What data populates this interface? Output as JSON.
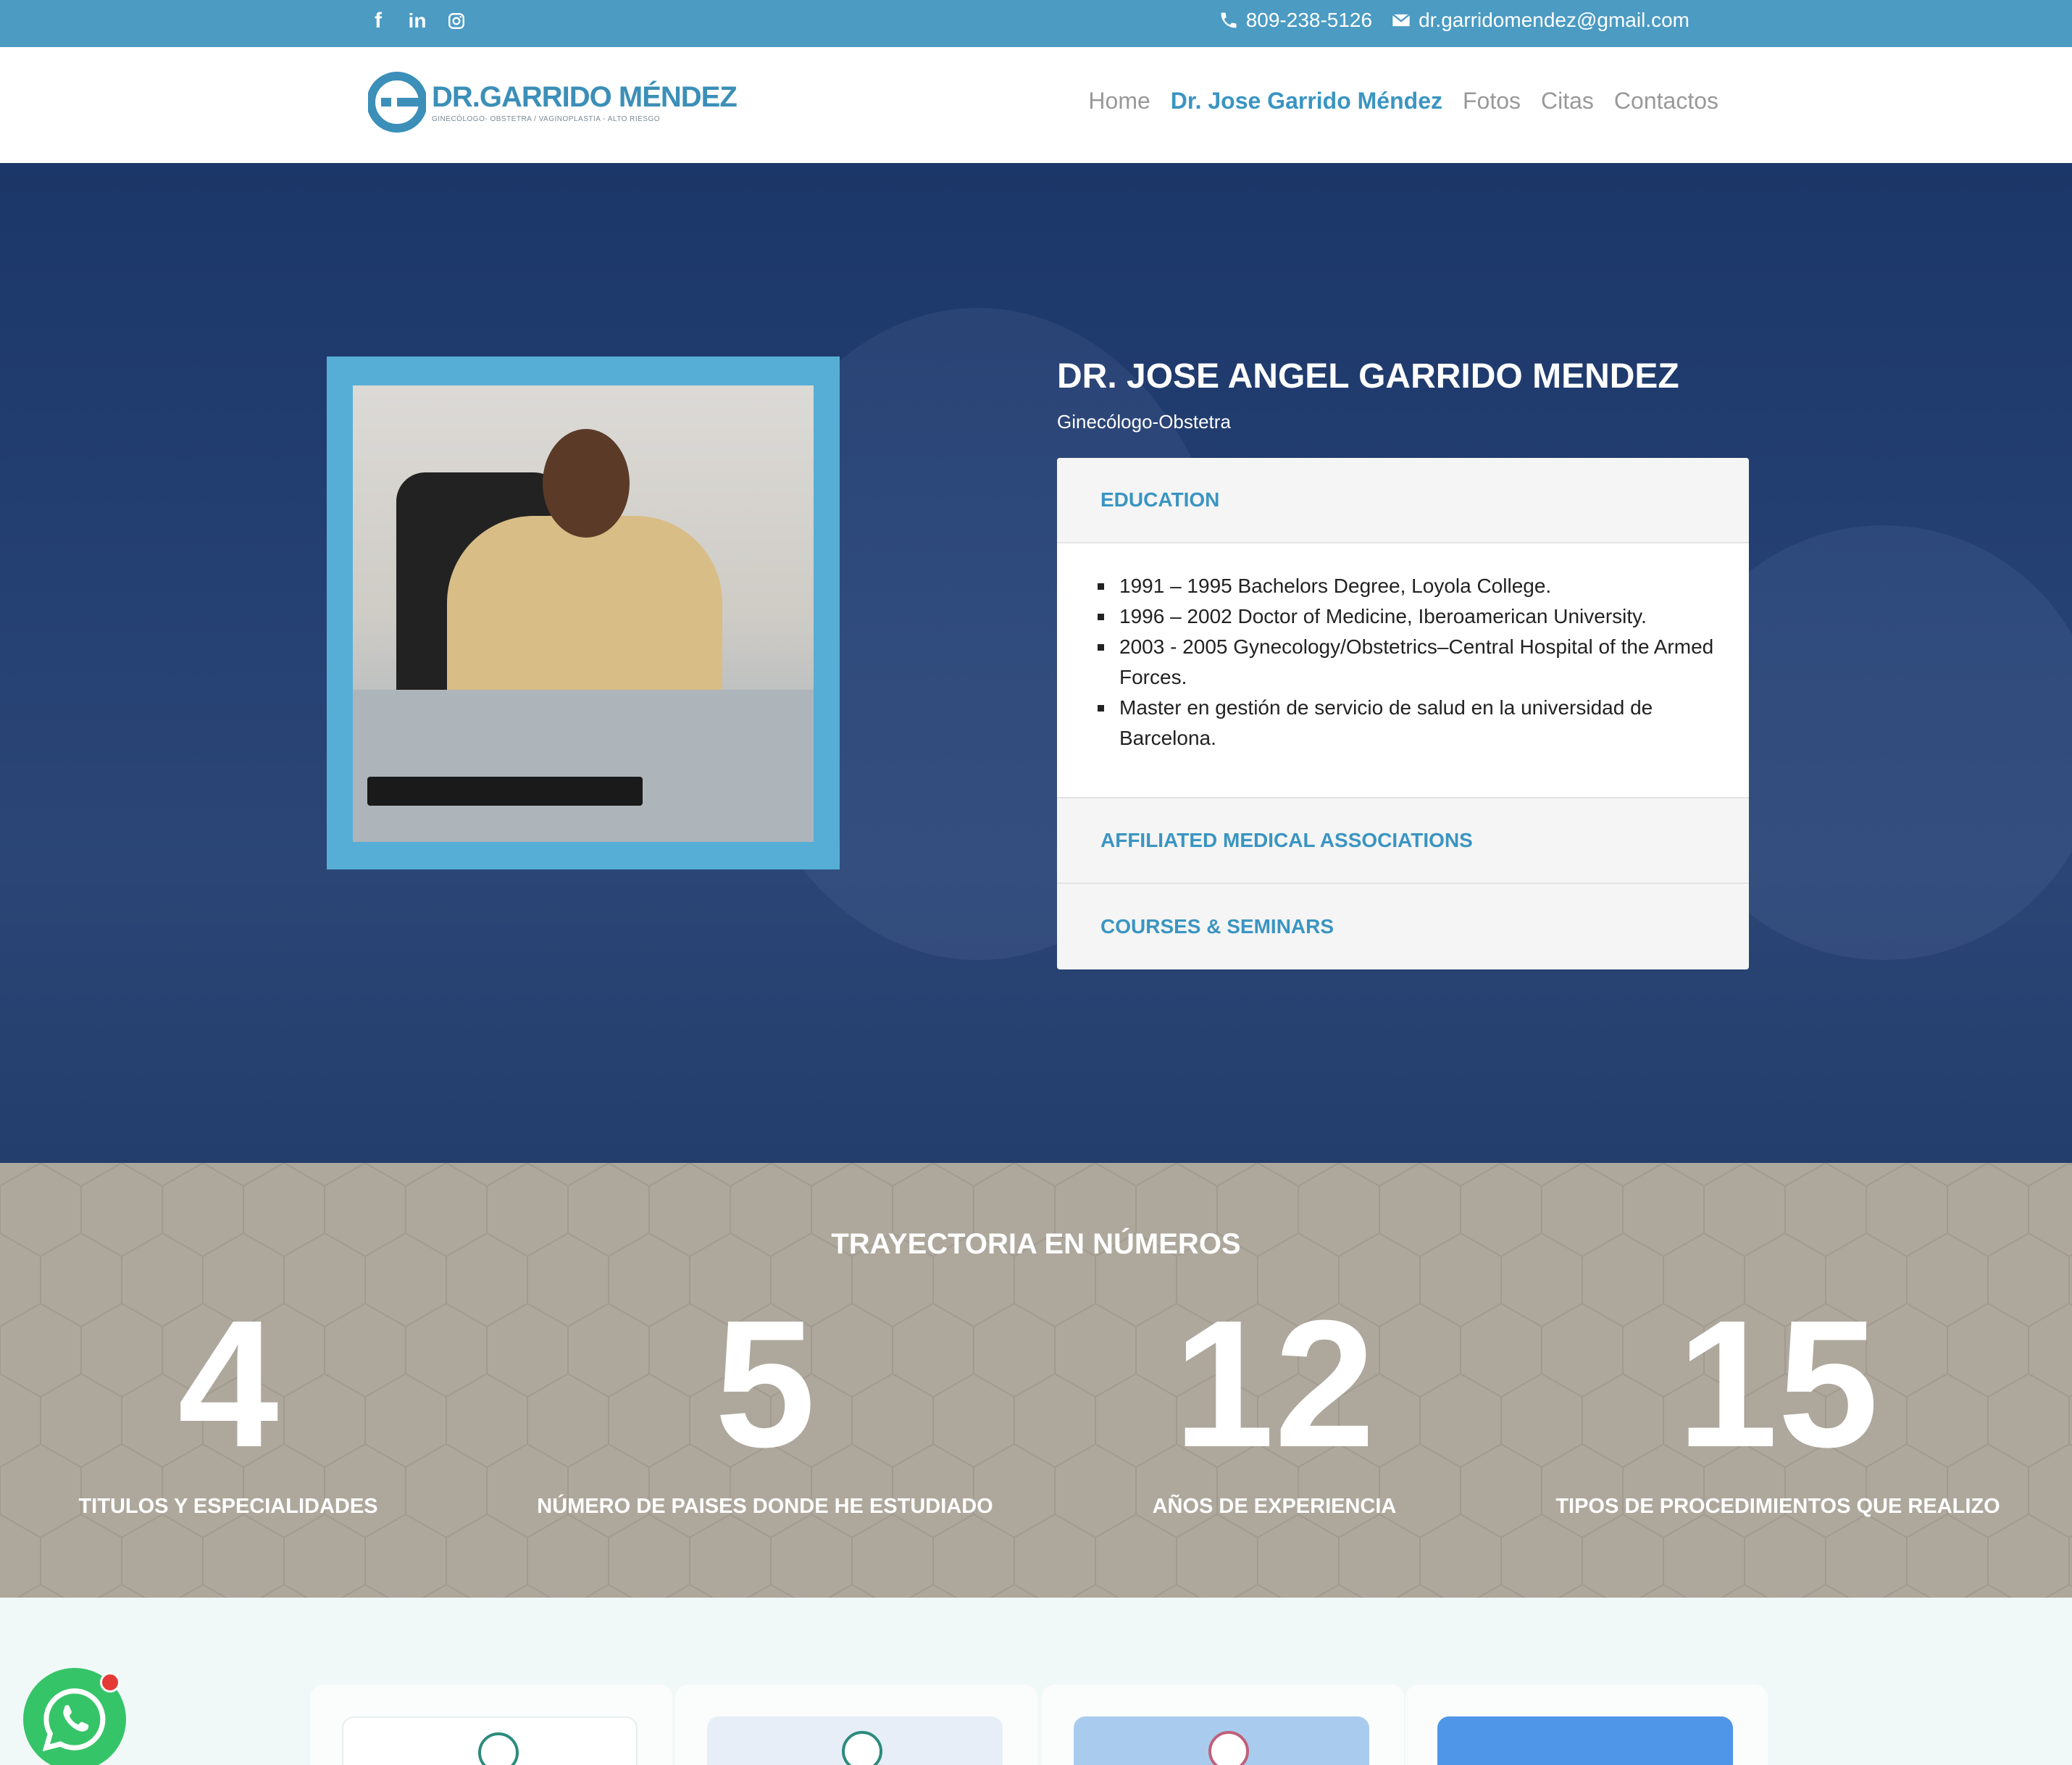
{
  "topbar": {
    "social": [
      "facebook-icon",
      "linkedin-icon",
      "instagram-icon"
    ],
    "phone": "809-238-5126",
    "email": "dr.garridomendez@gmail.com"
  },
  "header": {
    "logo_name": "DR.GARRIDO MÉNDEZ",
    "logo_tagline": "GINECÓLOGO- OBSTETRA / VAGINOPLASTIA - ALTO RIESGO",
    "nav": [
      "Home",
      "Dr. Jose Garrido Méndez",
      "Fotos",
      "Citas",
      "Contactos"
    ]
  },
  "profile": {
    "name": "DR. JOSE ANGEL GARRIDO MENDEZ",
    "role": "Ginecólogo-Obstetra",
    "sections": [
      {
        "title": "EDUCATION",
        "items": [
          "1991 – 1995 Bachelors Degree, Loyola College.",
          "1996 – 2002 Doctor of Medicine, Iberoamerican University.",
          "2003 - 2005 Gynecology/Obstetrics–Central Hospital of the Armed Forces.",
          "Master en gestión de servicio de salud en la universidad de Barcelona."
        ]
      },
      {
        "title": "AFFILIATED MEDICAL ASSOCIATIONS"
      },
      {
        "title": "COURSES & SEMINARS"
      }
    ]
  },
  "stats": {
    "title": "TRAYECTORIA EN NÚMEROS",
    "items": [
      {
        "value": "4",
        "label": "TITULOS Y ESPECIALIDADES"
      },
      {
        "value": "5",
        "label": "NÚMERO DE PAISES DONDE HE ESTUDIADO"
      },
      {
        "value": "12",
        "label": "AÑOS DE EXPERIENCIA"
      },
      {
        "value": "15",
        "label": "TIPOS DE PROCEDIMIENTOS QUE REALIZO"
      }
    ]
  },
  "colors": {
    "topbar": "#4b9bc3",
    "accent": "#3a95c2",
    "hero": "#1b3668",
    "stats_bg": "#aea79c",
    "whatsapp": "#36c468"
  }
}
